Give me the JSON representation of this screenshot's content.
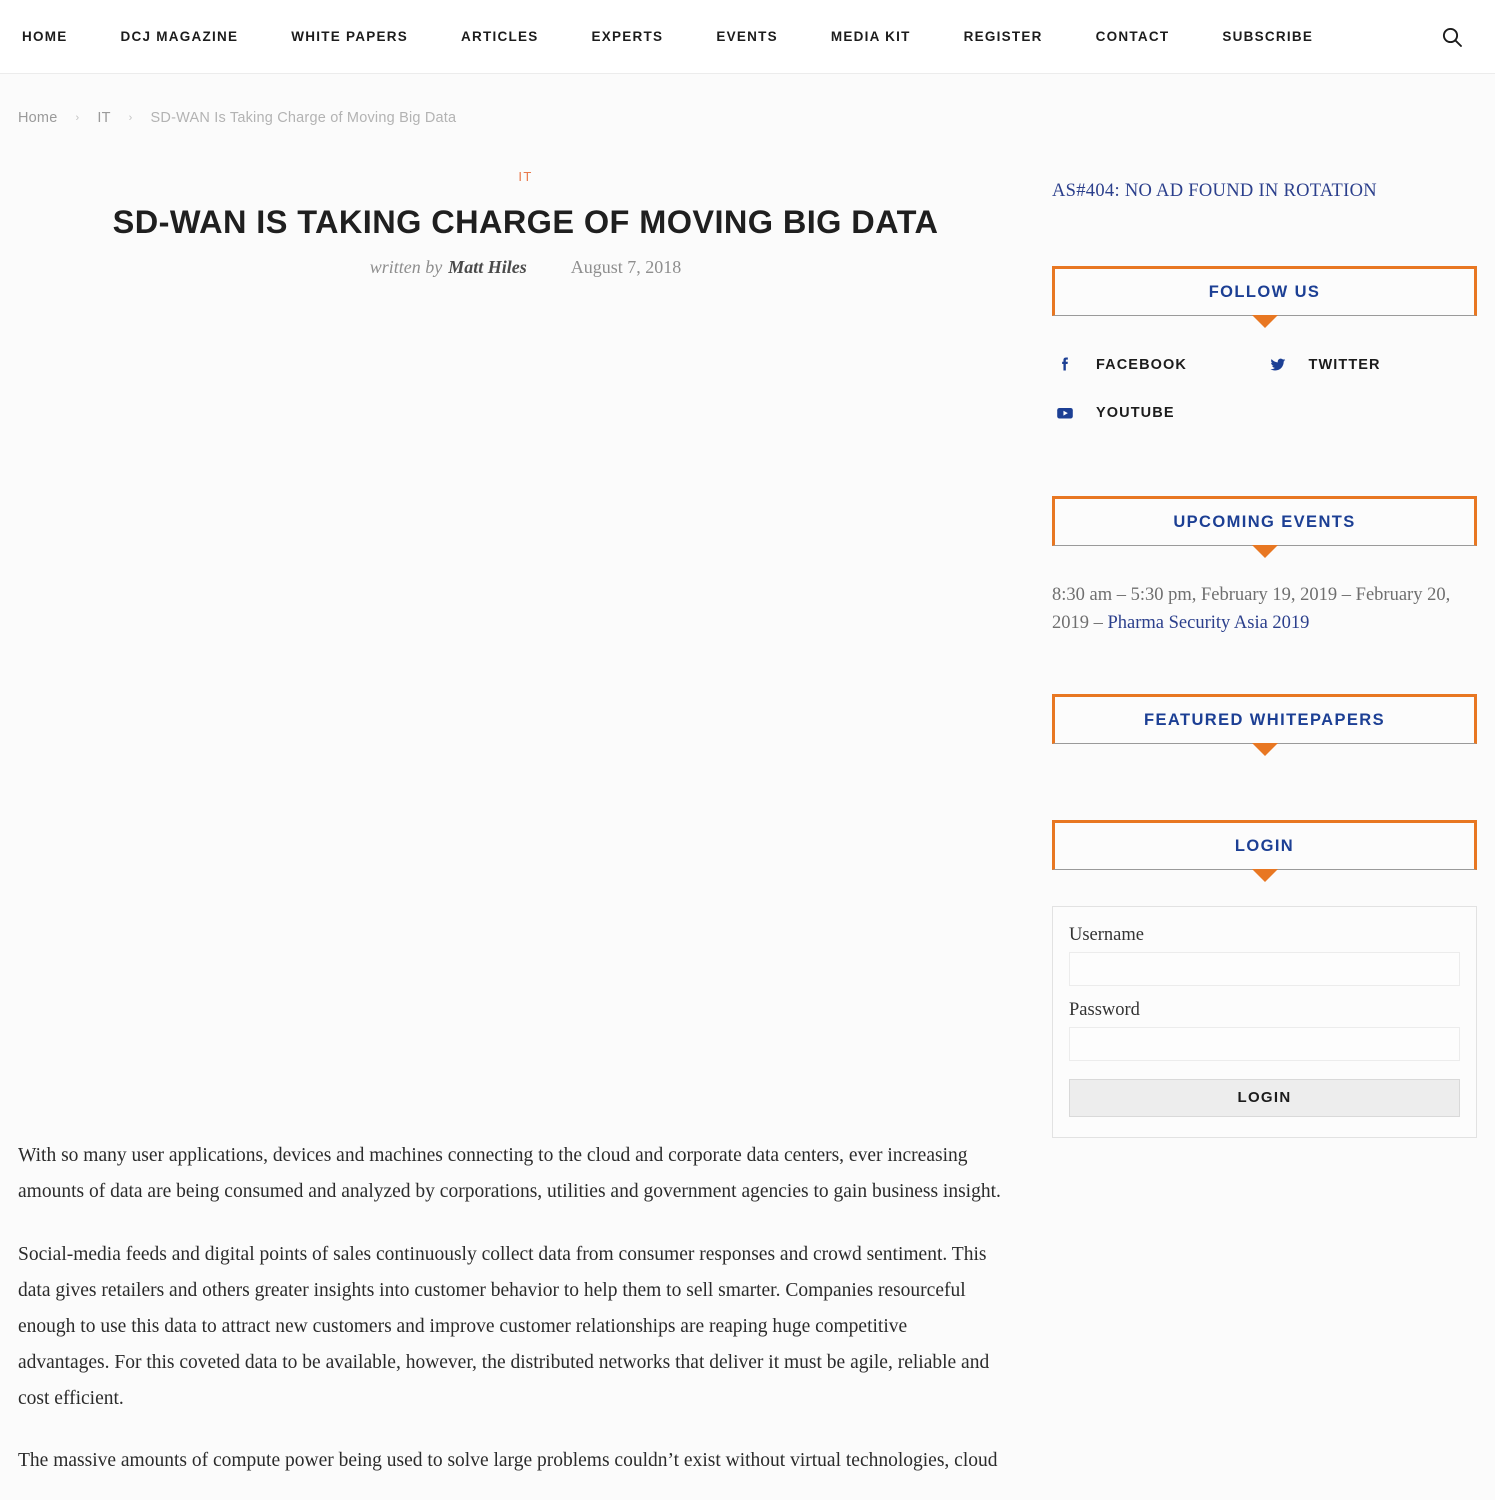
{
  "header": {
    "nav_items": [
      {
        "label": "HOME",
        "name": "nav-home"
      },
      {
        "label": "DCJ MAGAZINE",
        "name": "nav-dcj-magazine"
      },
      {
        "label": "WHITE PAPERS",
        "name": "nav-white-papers"
      },
      {
        "label": "ARTICLES",
        "name": "nav-articles"
      },
      {
        "label": "EXPERTS",
        "name": "nav-experts"
      },
      {
        "label": "EVENTS",
        "name": "nav-events"
      },
      {
        "label": "MEDIA KIT",
        "name": "nav-media-kit"
      },
      {
        "label": "REGISTER",
        "name": "nav-register"
      },
      {
        "label": "CONTACT",
        "name": "nav-contact"
      },
      {
        "label": "SUBSCRIBE",
        "name": "nav-subscribe"
      }
    ],
    "search_icon": "search-icon"
  },
  "breadcrumb": {
    "items": [
      {
        "label": "Home"
      },
      {
        "label": "IT"
      },
      {
        "label": "SD-WAN Is Taking Charge of Moving Big Data"
      }
    ],
    "separator": "›"
  },
  "article": {
    "category": "IT",
    "title": "SD-WAN IS TAKING CHARGE OF MOVING BIG DATA",
    "written_by_label": "written by",
    "author": "Matt Hiles",
    "date": "August 7, 2018",
    "paragraphs": [
      "With so many user applications, devices and machines connecting to the cloud and corporate data centers, ever increasing amounts of data are being consumed and analyzed by corporations, utilities and government agencies to gain business insight.",
      "Social-media feeds and digital points of sales continuously collect data from consumer responses and crowd sentiment. This data gives retailers and others greater insights into customer behavior to help them to sell smarter. Companies resourceful enough to use this data to attract new customers and improve customer relationships are reaping huge competitive advantages. For this coveted data to be available, however, the distributed networks that deliver it must be agile, reliable and cost efficient.",
      "The massive amounts of compute power being used to solve large problems couldn’t exist without virtual technologies, cloud"
    ]
  },
  "sidebar": {
    "ad_notice": "AS#404: NO AD FOUND IN ROTATION",
    "follow_us": {
      "title": "FOLLOW US",
      "links": [
        {
          "label": "FACEBOOK",
          "icon": "facebook-icon"
        },
        {
          "label": "TWITTER",
          "icon": "twitter-icon"
        },
        {
          "label": "YOUTUBE",
          "icon": "youtube-icon"
        }
      ]
    },
    "upcoming_events": {
      "title": "UPCOMING EVENTS",
      "event_time": "8:30 am – 5:30 pm, February 19, 2019 – February 20, 2019 – ",
      "event_link": "Pharma Security Asia 2019"
    },
    "featured_whitepapers": {
      "title": "FEATURED WHITEPAPERS"
    },
    "login": {
      "title": "LOGIN",
      "username_label": "Username",
      "username_value": "",
      "username_placeholder": "",
      "password_label": "Password",
      "password_value": "",
      "password_placeholder": "",
      "submit_label": "LOGIN"
    }
  },
  "colors": {
    "accent_orange": "#e87722",
    "link_blue": "#1c3f94",
    "category_orange": "#e8784a",
    "page_bg": "#fbfbfb"
  }
}
